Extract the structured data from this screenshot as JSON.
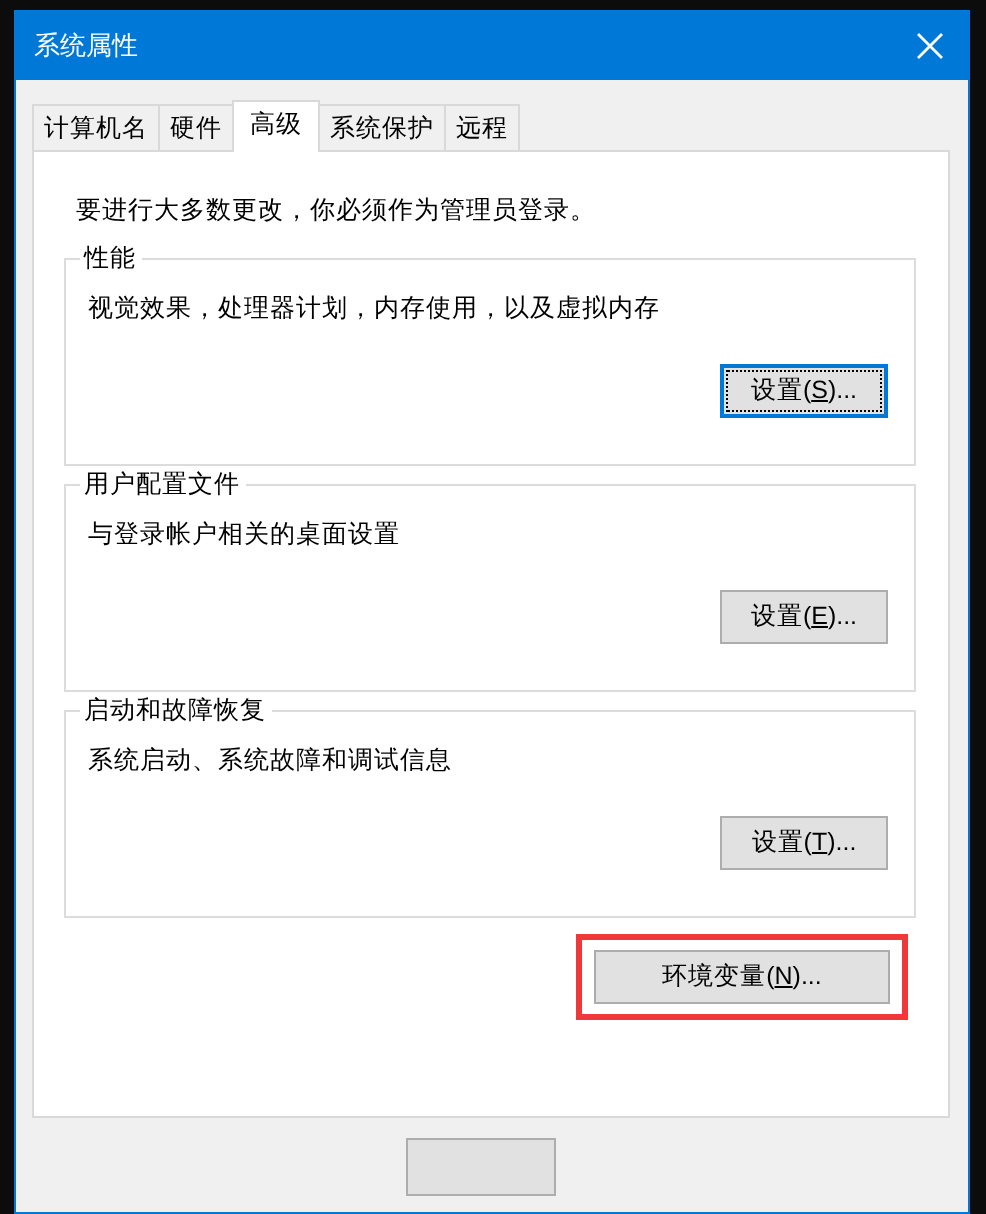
{
  "window": {
    "title": "系统属性"
  },
  "tabs": [
    {
      "label": "计算机名",
      "selected": false
    },
    {
      "label": "硬件",
      "selected": false
    },
    {
      "label": "高级",
      "selected": true
    },
    {
      "label": "系统保护",
      "selected": false
    },
    {
      "label": "远程",
      "selected": false
    }
  ],
  "notice": "要进行大多数更改，你必须作为管理员登录。",
  "groups": [
    {
      "title": "性能",
      "description": "视觉效果，处理器计划，内存使用，以及虚拟内存",
      "button": {
        "label_before": "设置(",
        "access_key": "S",
        "label_after": ")...",
        "focused": true
      }
    },
    {
      "title": "用户配置文件",
      "description": "与登录帐户相关的桌面设置",
      "button": {
        "label_before": "设置(",
        "access_key": "E",
        "label_after": ")...",
        "focused": false
      }
    },
    {
      "title": "启动和故障恢复",
      "description": "系统启动、系统故障和调试信息",
      "button": {
        "label_before": "设置(",
        "access_key": "T",
        "label_after": ")...",
        "focused": false
      }
    }
  ],
  "env_button": {
    "label_before": "环境变量(",
    "access_key": "N",
    "label_after": ")...",
    "highlighted": true
  }
}
